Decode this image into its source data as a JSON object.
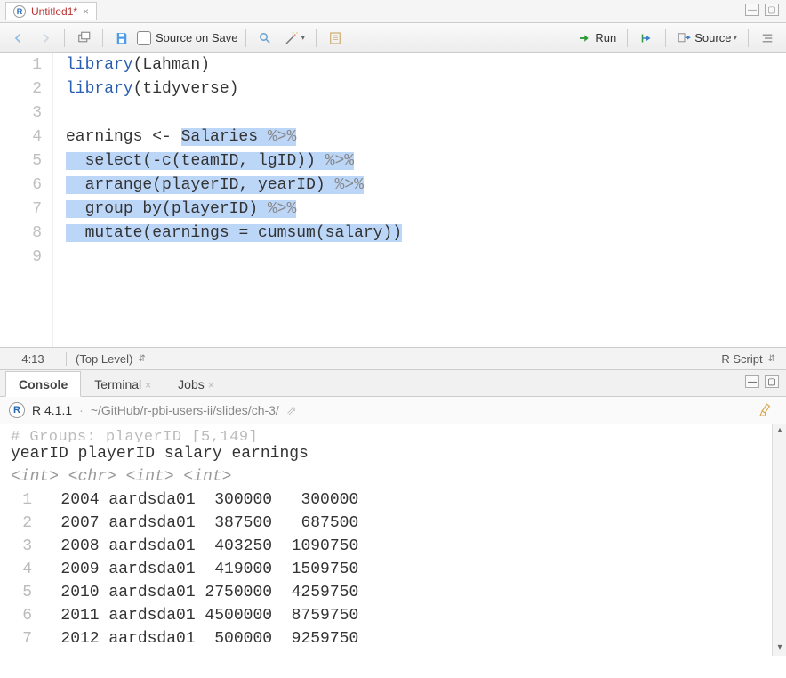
{
  "tab": {
    "title": "Untitled1*"
  },
  "toolbar": {
    "source_on_save_label": "Source on Save",
    "run_label": "Run",
    "source_label": "Source"
  },
  "editor": {
    "lines": [
      {
        "n": 1,
        "segments": [
          {
            "t": "library",
            "cls": "kw"
          },
          {
            "t": "(Lahman)",
            "cls": ""
          }
        ]
      },
      {
        "n": 2,
        "segments": [
          {
            "t": "library",
            "cls": "kw"
          },
          {
            "t": "(tidyverse)",
            "cls": ""
          }
        ]
      },
      {
        "n": 3,
        "segments": []
      },
      {
        "n": 4,
        "segments": [
          {
            "t": "earnings <- ",
            "cls": ""
          },
          {
            "t": "Salaries ",
            "cls": "hl-span"
          },
          {
            "t": "%>%",
            "cls": "op hl-span"
          }
        ],
        "trail_hl": true
      },
      {
        "n": 5,
        "segments": [
          {
            "t": "  ",
            "cls": "hl-span"
          },
          {
            "t": "select",
            "cls": "hl-span"
          },
          {
            "t": "(-",
            "cls": "hl-span"
          },
          {
            "t": "c",
            "cls": "hl-span"
          },
          {
            "t": "(teamID, lgID)) ",
            "cls": "hl-span"
          },
          {
            "t": "%>%",
            "cls": "op hl-span"
          }
        ],
        "trail_hl": true
      },
      {
        "n": 6,
        "segments": [
          {
            "t": "  ",
            "cls": "hl-span"
          },
          {
            "t": "arrange",
            "cls": "hl-span"
          },
          {
            "t": "(playerID, yearID) ",
            "cls": "hl-span"
          },
          {
            "t": "%>%",
            "cls": "op hl-span"
          }
        ],
        "trail_hl": true
      },
      {
        "n": 7,
        "segments": [
          {
            "t": "  ",
            "cls": "hl-span"
          },
          {
            "t": "group_by",
            "cls": "hl-span"
          },
          {
            "t": "(playerID) ",
            "cls": "hl-span"
          },
          {
            "t": "%>%",
            "cls": "op hl-span"
          }
        ],
        "trail_hl": true
      },
      {
        "n": 8,
        "segments": [
          {
            "t": "  ",
            "cls": "hl-span"
          },
          {
            "t": "mutate",
            "cls": "hl-span"
          },
          {
            "t": "(earnings = ",
            "cls": "hl-span"
          },
          {
            "t": "cumsum",
            "cls": "hl-span"
          },
          {
            "t": "(salary))",
            "cls": "hl-span"
          }
        ]
      },
      {
        "n": 9,
        "segments": []
      }
    ],
    "cursor_pos": "4:13",
    "scope": "(Top Level)",
    "language": "R Script"
  },
  "pane_tabs": {
    "console": "Console",
    "terminal": "Terminal",
    "jobs": "Jobs"
  },
  "console": {
    "version": "R 4.1.1",
    "path": "~/GitHub/r-pbi-users-ii/slides/ch-3/",
    "truncated_line": "# Groups:   playerID [5,149]",
    "header": "   yearID playerID    salary earnings",
    "types": "    <int> <chr>        <int>    <int>",
    "rows": [
      {
        "n": 1,
        "text": "   2004 aardsda01  300000   300000"
      },
      {
        "n": 2,
        "text": "   2007 aardsda01  387500   687500"
      },
      {
        "n": 3,
        "text": "   2008 aardsda01  403250  1090750"
      },
      {
        "n": 4,
        "text": "   2009 aardsda01  419000  1509750"
      },
      {
        "n": 5,
        "text": "   2010 aardsda01 2750000  4259750"
      },
      {
        "n": 6,
        "text": "   2011 aardsda01 4500000  8759750"
      },
      {
        "n": 7,
        "text": "   2012 aardsda01  500000  9259750"
      }
    ]
  }
}
